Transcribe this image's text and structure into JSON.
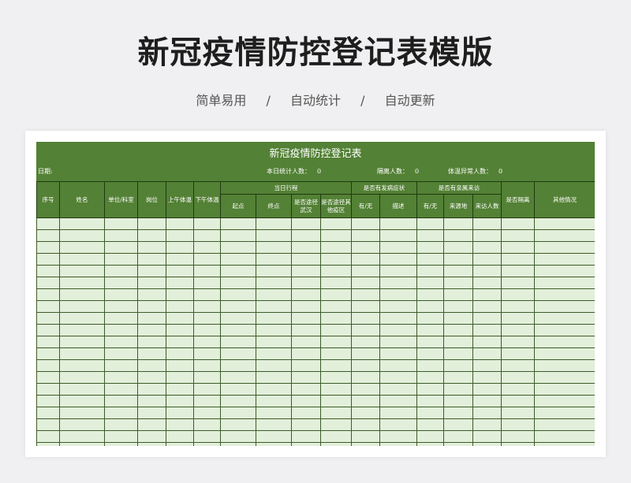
{
  "page": {
    "title": "新冠疫情防控登记表模版",
    "subtitle_items": [
      "简单易用",
      "/",
      "自动统计",
      "/",
      "自动更新"
    ]
  },
  "sheet": {
    "title": "新冠疫情防控登记表",
    "date_label": "日期:",
    "stats": [
      {
        "label": "本日统计人数：",
        "value": "0"
      },
      {
        "label": "隔离人数：",
        "value": "0"
      },
      {
        "label": "体温异常人数：",
        "value": "0"
      }
    ],
    "headers": {
      "seq": "序号",
      "name": "姓名",
      "dept": "单位/科室",
      "post": "岗位",
      "am_temp": "上午体温",
      "pm_temp": "下午体温",
      "trip": "当日行程",
      "trip_start": "起点",
      "trip_end": "终点",
      "via_wuhan": "是否途径武汉",
      "via_epidemic": "是否途径其他疫区",
      "symptom": "是否有发病症状",
      "symptom_yn": "有/无",
      "symptom_desc": "描述",
      "visit": "是否有亲属来访",
      "visit_yn": "有/无",
      "visit_from": "来源地",
      "visit_count": "来访人数",
      "isolated": "是否隔离",
      "other": "其他情况"
    },
    "colors": {
      "header_green": "#538135",
      "row_green": "#e2efda",
      "border": "#1f3a10"
    },
    "empty_rows": 20
  }
}
